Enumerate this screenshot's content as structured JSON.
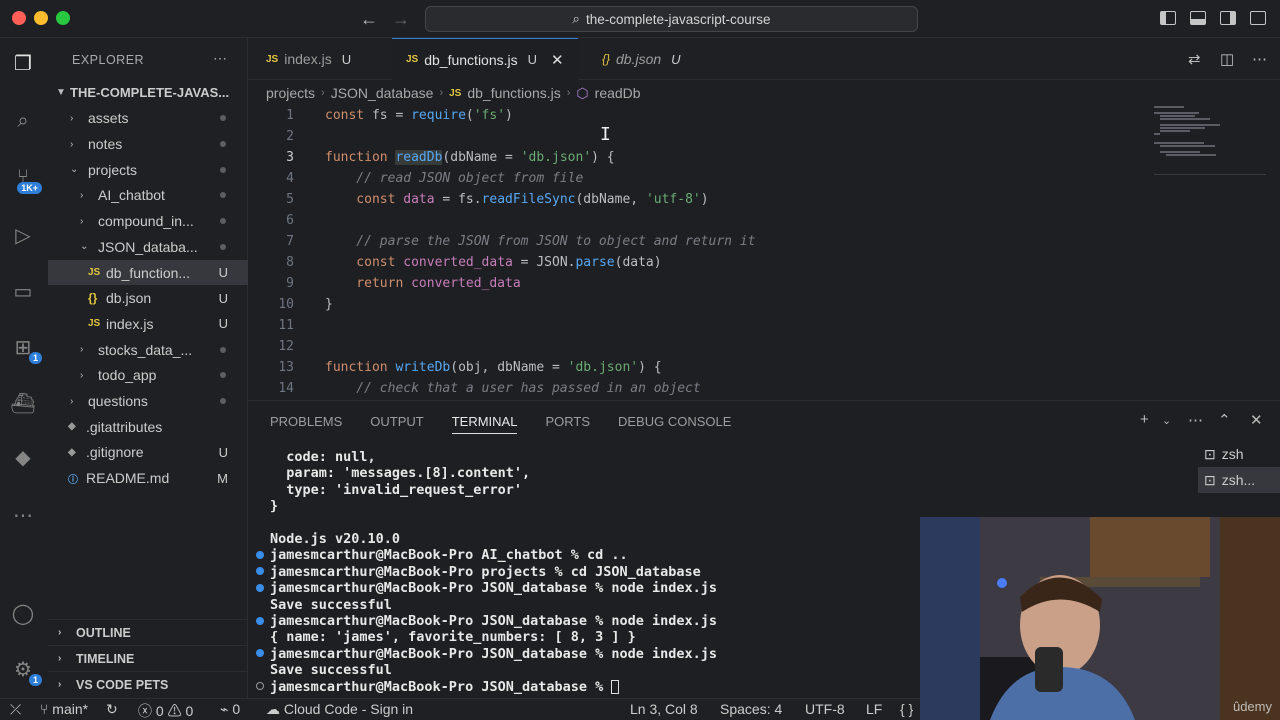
{
  "window": {
    "search_text": "the-complete-javascript-course"
  },
  "activity_bar": {
    "source_control_badge": "1K+",
    "remote_badge": "1",
    "accounts_badge": "1"
  },
  "sidebar": {
    "title": "EXPLORER",
    "repo": "THE-COMPLETE-JAVAS...",
    "items": [
      {
        "label": "assets",
        "status": ""
      },
      {
        "label": "notes",
        "status": ""
      },
      {
        "label": "projects",
        "status": ""
      },
      {
        "label": "AI_chatbot",
        "status": ""
      },
      {
        "label": "compound_in...",
        "status": ""
      },
      {
        "label": "JSON_databa...",
        "status": ""
      },
      {
        "label": "db_function...",
        "status": "U"
      },
      {
        "label": "db.json",
        "status": "U"
      },
      {
        "label": "index.js",
        "status": "U"
      },
      {
        "label": "stocks_data_...",
        "status": ""
      },
      {
        "label": "todo_app",
        "status": ""
      },
      {
        "label": "questions",
        "status": ""
      },
      {
        "label": ".gitattributes",
        "status": ""
      },
      {
        "label": ".gitignore",
        "status": "U"
      },
      {
        "label": "README.md",
        "status": "M"
      }
    ],
    "sections": [
      "OUTLINE",
      "TIMELINE",
      "VS CODE PETS"
    ]
  },
  "tabs": [
    {
      "label": "index.js",
      "status": "U",
      "icon": "JS"
    },
    {
      "label": "db_functions.js",
      "status": "U",
      "icon": "JS"
    },
    {
      "label": "db.json",
      "status": "U",
      "icon": "{}"
    }
  ],
  "breadcrumb": [
    "projects",
    "JSON_database",
    "db_functions.js",
    "readDb"
  ],
  "code": {
    "line_numbers": [
      "1",
      "2",
      "3",
      "4",
      "5",
      "6",
      "7",
      "8",
      "9",
      "10",
      "11",
      "12",
      "13",
      "14"
    ]
  },
  "panel": {
    "tabs": [
      "PROBLEMS",
      "OUTPUT",
      "TERMINAL",
      "PORTS",
      "DEBUG CONSOLE"
    ],
    "terminal_lines": [
      "  code: null,",
      "  param: 'messages.[8].content',",
      "  type: 'invalid_request_error'",
      "}",
      "",
      "Node.js v20.10.0",
      "jamesmcarthur@MacBook-Pro AI_chatbot % cd ..",
      "jamesmcarthur@MacBook-Pro projects % cd JSON_database",
      "jamesmcarthur@MacBook-Pro JSON_database % node index.js",
      "Save successful",
      "jamesmcarthur@MacBook-Pro JSON_database % node index.js",
      "{ name: 'james', favorite_numbers: [ 8, 3 ] }",
      "jamesmcarthur@MacBook-Pro JSON_database % node index.js",
      "Save successful",
      "jamesmcarthur@MacBook-Pro JSON_database % "
    ],
    "terminals": [
      "zsh",
      "zsh..."
    ]
  },
  "statusbar": {
    "branch": "main*",
    "errors": "0",
    "warnings": "0",
    "ports": "0",
    "cloud": "Cloud Code - Sign in",
    "position": "Ln 3, Col 8",
    "spaces": "Spaces: 4",
    "encoding": "UTF-8",
    "eol": "LF",
    "language": "{ }"
  },
  "watermark": "ûdemy",
  "colors": {
    "accent": "#2f7fd9",
    "keyword": "#cf8e6d",
    "function": "#56a8f5",
    "string": "#6aab73"
  }
}
